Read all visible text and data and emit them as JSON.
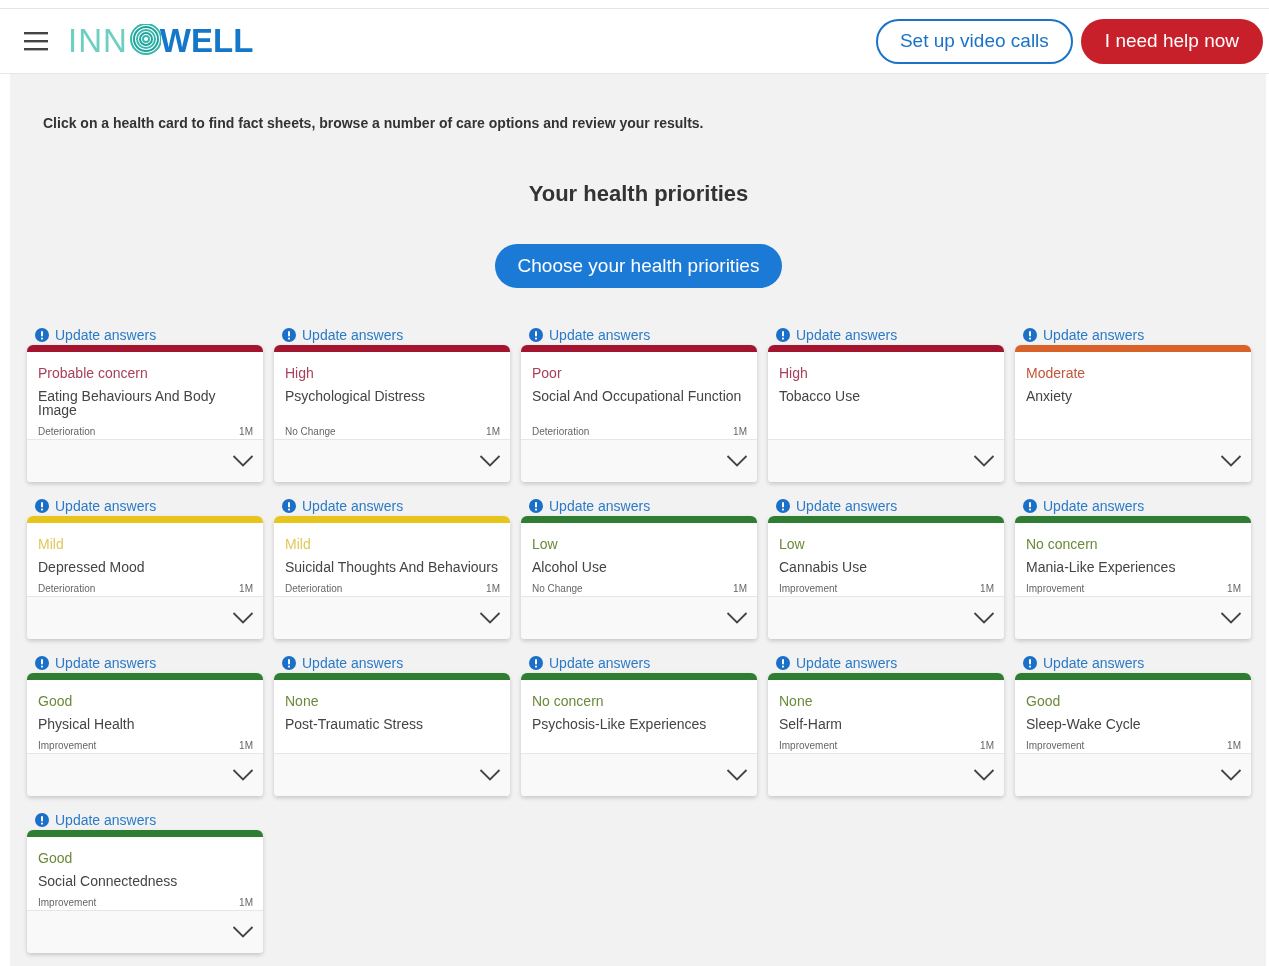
{
  "header": {
    "logo": {
      "left": "INN",
      "right": "WELL"
    },
    "buttons": [
      {
        "label": "Set up video calls",
        "kind": "outline"
      },
      {
        "label": "I need help now",
        "kind": "danger"
      }
    ]
  },
  "intro": "Click on a health card to find fact sheets, browse a number of care options and review your results.",
  "title": "Your health priorities",
  "primary_button": "Choose your health priorities",
  "cards": [
    {
      "update": "Update answers",
      "level": "Probable concern",
      "name": "Eating Behaviours And Body Image",
      "trend": "Deterioration",
      "period": "1M",
      "color": "#a3152f"
    },
    {
      "update": "Update answers",
      "level": "High",
      "name": "Psychological Distress",
      "trend": "No Change",
      "period": "1M",
      "color": "#a3152f"
    },
    {
      "update": "Update answers",
      "level": "Poor",
      "name": "Social And Occupational Function",
      "trend": "Deterioration",
      "period": "1M",
      "color": "#a3152f"
    },
    {
      "update": "Update answers",
      "level": "High",
      "name": "Tobacco Use",
      "color": "#a3152f"
    },
    {
      "update": "Update answers",
      "level": "Moderate",
      "name": "Anxiety",
      "color": "#d9622b"
    },
    {
      "update": "Update answers",
      "level": "Mild",
      "name": "Depressed Mood",
      "trend": "Deterioration",
      "period": "1M",
      "color": "#e8c51c"
    },
    {
      "update": "Update answers",
      "level": "Mild",
      "name": "Suicidal Thoughts And Behaviours",
      "trend": "Deterioration",
      "period": "1M",
      "color": "#e8c51c"
    },
    {
      "update": "Update answers",
      "level": "Low",
      "name": "Alcohol Use",
      "trend": "No Change",
      "period": "1M",
      "color": "#2e7d32"
    },
    {
      "update": "Update answers",
      "level": "Low",
      "name": "Cannabis Use",
      "trend": "Improvement",
      "period": "1M",
      "color": "#2e7d32"
    },
    {
      "update": "Update answers",
      "level": "No concern",
      "name": "Mania-Like Experiences",
      "trend": "Improvement",
      "period": "1M",
      "color": "#2e7d32"
    },
    {
      "update": "Update answers",
      "level": "Good",
      "name": "Physical Health",
      "trend": "Improvement",
      "period": "1M",
      "color": "#2e7d32"
    },
    {
      "update": "Update answers",
      "level": "None",
      "name": "Post-Traumatic Stress",
      "color": "#2e7d32"
    },
    {
      "update": "Update answers",
      "level": "No concern",
      "name": "Psychosis-Like Experiences",
      "color": "#2e7d32"
    },
    {
      "update": "Update answers",
      "level": "None",
      "name": "Self-Harm",
      "trend": "Improvement",
      "period": "1M",
      "color": "#2e7d32"
    },
    {
      "update": "Update answers",
      "level": "Good",
      "name": "Sleep-Wake Cycle",
      "trend": "Improvement",
      "period": "1M",
      "color": "#2e7d32"
    },
    {
      "update": "Update answers",
      "level": "Good",
      "name": "Social Connectedness",
      "trend": "Improvement",
      "period": "1M",
      "color": "#2e7d32"
    }
  ]
}
